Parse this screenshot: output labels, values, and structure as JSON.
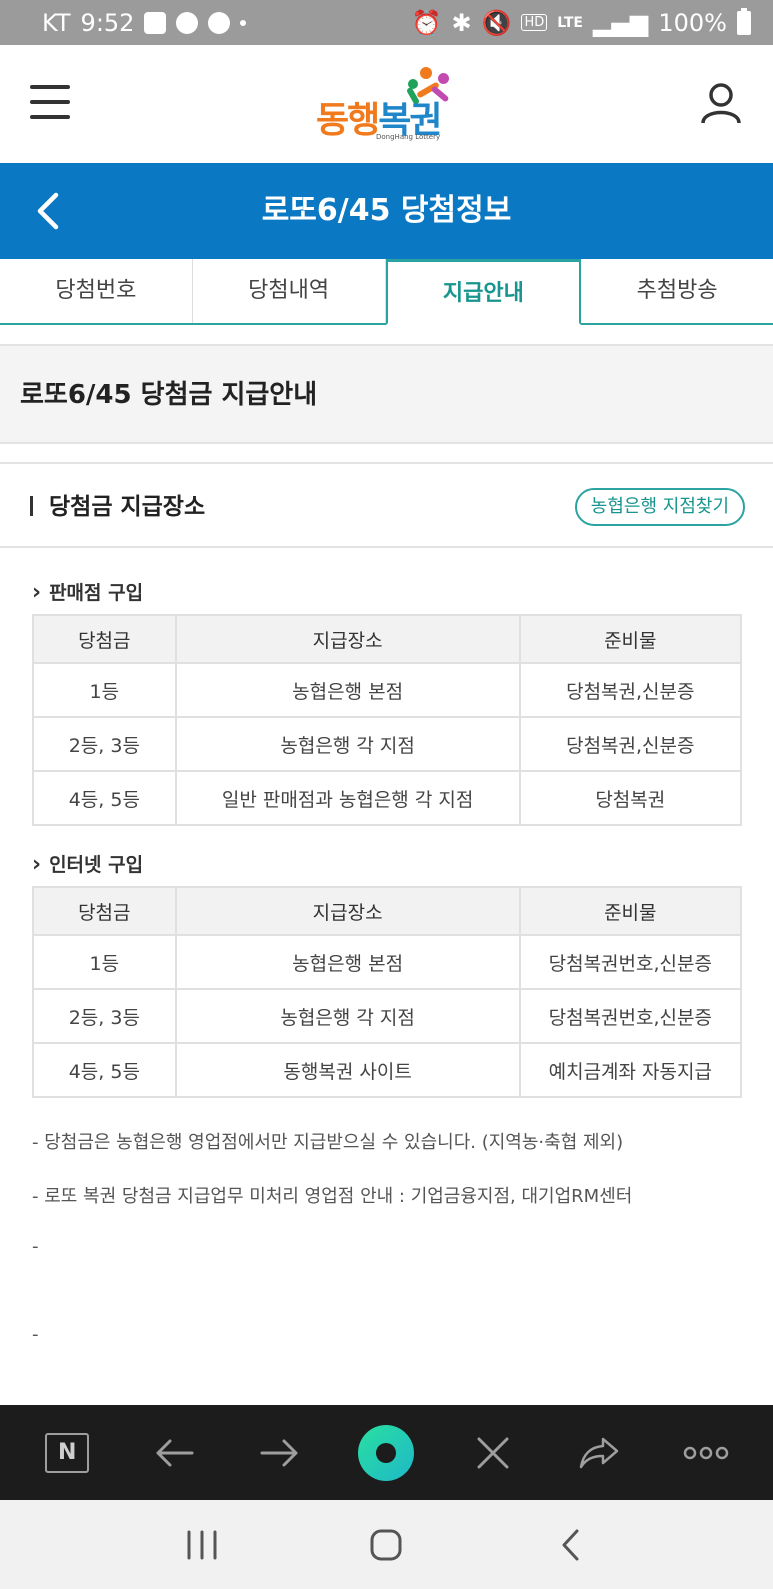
{
  "status_bar": {
    "carrier": "KT",
    "time": "9:52",
    "network": "LTE",
    "hd": "HD",
    "battery": "100%"
  },
  "header": {
    "logo_part1": "동행",
    "logo_part2": "복권",
    "logo_sub": "DongHang Lottery"
  },
  "titlebar": {
    "title": "로또6/45 당첨정보"
  },
  "tabs": [
    {
      "label": "당첨번호"
    },
    {
      "label": "당첨내역"
    },
    {
      "label": "지급안내"
    },
    {
      "label": "추첨방송"
    }
  ],
  "section_title": "로또6/45 당첨금 지급안내",
  "subhead": {
    "title": "당첨금 지급장소",
    "branch_button": "농협은행 지점찾기"
  },
  "store_purchase": {
    "label": "판매점 구입",
    "headers": [
      "당첨금",
      "지급장소",
      "준비물"
    ],
    "rows": [
      [
        "1등",
        "농협은행 본점",
        "당첨복권,신분증"
      ],
      [
        "2등, 3등",
        "농협은행 각 지점",
        "당첨복권,신분증"
      ],
      [
        "4등, 5등",
        "일반 판매점과 농협은행 각 지점",
        "당첨복권"
      ]
    ]
  },
  "internet_purchase": {
    "label": "인터넷 구입",
    "headers": [
      "당첨금",
      "지급장소",
      "준비물"
    ],
    "rows": [
      [
        "1등",
        "농협은행 본점",
        "당첨복권번호,신분증"
      ],
      [
        "2등, 3등",
        "농협은행 각 지점",
        "당첨복권번호,신분증"
      ],
      [
        "4등, 5등",
        "동행복권 사이트",
        "예치금계좌 자동지급"
      ]
    ]
  },
  "notes": [
    "- 당첨금은 농협은행 영업점에서만 지급받으실 수 있습니다. (지역농·축협 제외)",
    "- 로또 복권 당첨금 지급업무 미처리 영업점 안내 : 기업금융지점, 대기업RM센터",
    "-",
    "-"
  ],
  "browser_bar": {
    "n_label": "N"
  },
  "colors": {
    "primary_blue": "#0b78c3",
    "teal": "#2aa4a0",
    "logo_orange": "#f07a1c",
    "logo_blue": "#1f86c9"
  }
}
